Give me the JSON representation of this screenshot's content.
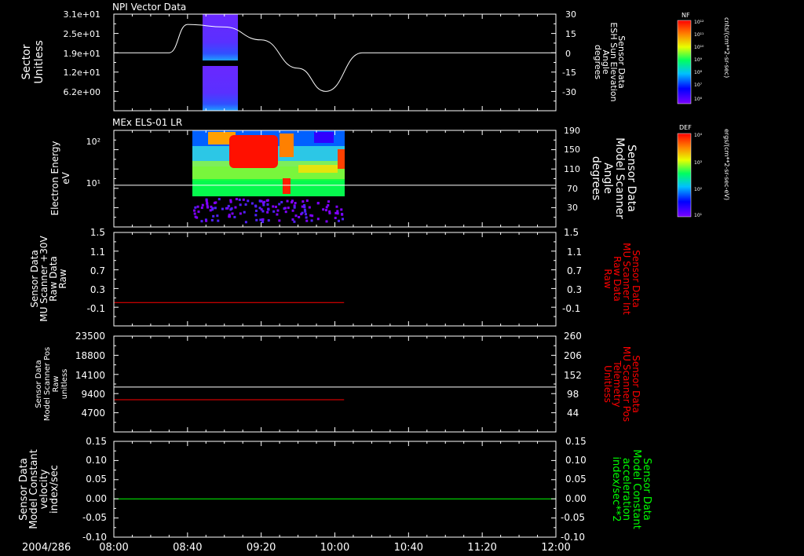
{
  "date_label": "2004/286",
  "x_ticks": [
    "08:00",
    "08:40",
    "09:20",
    "10:00",
    "10:40",
    "11:20",
    "12:00"
  ],
  "colorbars": [
    {
      "tag": "NF",
      "unit": "cnts/(cm**2-sr-sec)",
      "ticks": [
        "10¹²",
        "10¹¹",
        "10¹⁰",
        "10⁹",
        "10⁸",
        "10⁷",
        "10⁶"
      ]
    },
    {
      "tag": "DEF",
      "unit": "ergs/(cm**2-sr-sec-eV)",
      "ticks": [
        "10⁴",
        "10³",
        "10²",
        "10¹"
      ]
    }
  ],
  "colors": {
    "white": "#ffffff",
    "red": "#ff0000",
    "green": "#00ff00",
    "frame": "#ffffff"
  },
  "chart_data": [
    {
      "type": "heatmap",
      "title": "NPI Vector Data",
      "ylabel_left": [
        "Sector",
        "Unitless"
      ],
      "left_ticks": [
        "3.1e+01",
        "2.5e+01",
        "1.9e+01",
        "1.2e+01",
        "6.2e+00"
      ],
      "ylabel_right": [
        "Sensor Data",
        "ESH Sun Elevation",
        "Angle",
        "degrees"
      ],
      "right_ticks": [
        "30",
        "15",
        "0",
        "-15",
        "-30"
      ],
      "right_ylim": [
        -45,
        30
      ],
      "line_color": "#ffffff",
      "line_series": {
        "x": [
          "08:00",
          "08:30",
          "08:40",
          "09:00",
          "09:20",
          "09:40",
          "09:55",
          "10:15",
          "12:00"
        ],
        "y": [
          0,
          0,
          22,
          20,
          10,
          -12,
          -30,
          0,
          0
        ]
      }
    },
    {
      "type": "heatmap",
      "title": "MEx ELS-01 LR",
      "ylabel_left": [
        "Electron Energy",
        "eV"
      ],
      "left_ticks": [
        "10²",
        "10¹"
      ],
      "ylabel_right": [
        "Sensor Data",
        "Model Scanner",
        "Angle",
        "degrees"
      ],
      "right_ticks": [
        "190",
        "150",
        "110",
        "70",
        "30"
      ],
      "right_ylim": [
        0,
        190
      ],
      "line_color": "#ffffff",
      "line_value": 82
    },
    {
      "type": "line",
      "ylabel_left": [
        "Sensor Data",
        "MU Scanner +30V",
        "Raw Data",
        "Raw"
      ],
      "left_ticks": [
        "1.5",
        "1.1",
        "0.7",
        "0.3",
        "-0.1"
      ],
      "ylim": [
        -0.5,
        1.5
      ],
      "ylabel_right": [
        "Sensor Data",
        "MU Scanner Int",
        "Raw Data",
        "Raw"
      ],
      "right_ticks": [
        "1.5",
        "1.1",
        "0.7",
        "0.3",
        "-0.1"
      ],
      "series": [
        {
          "color": "#ff0000",
          "x": [
            "08:00",
            "10:05"
          ],
          "y": [
            0,
            0
          ]
        }
      ]
    },
    {
      "type": "line",
      "ylabel_left": [
        "Sensor Data",
        "Model Scanner Pos",
        "Raw",
        "unitless"
      ],
      "left_ticks": [
        "23500",
        "18800",
        "14100",
        "9400",
        "4700"
      ],
      "ylim": [
        0,
        23500
      ],
      "ylabel_right": [
        "Sensor Data",
        "MU Scanner Pos",
        "Telemetry",
        "Unitless"
      ],
      "right_ticks": [
        "260",
        "206",
        "152",
        "98",
        "44"
      ],
      "right_ylim": [
        -10,
        260
      ],
      "series": [
        {
          "color": "#ffffff",
          "x": [
            "08:00",
            "12:00"
          ],
          "y": [
            11000,
            11000
          ]
        },
        {
          "color": "#ff0000",
          "x": [
            "08:00",
            "10:05"
          ],
          "y": [
            7900,
            7900
          ]
        }
      ]
    },
    {
      "type": "line",
      "ylabel_left": [
        "Sensor Data",
        "Model Constant",
        "velocity",
        "index/sec"
      ],
      "left_ticks": [
        "0.15",
        "0.10",
        "0.05",
        "0.00",
        "-0.05",
        "-0.10"
      ],
      "ylim": [
        -0.1,
        0.15
      ],
      "ylabel_right": [
        "Sensor Data",
        "Model Constant",
        "acceleration",
        "index/sec**2"
      ],
      "right_ticks": [
        "0.15",
        "0.10",
        "0.05",
        "0.00",
        "-0.05",
        "-0.10"
      ],
      "series": [
        {
          "color": "#00ff00",
          "x": [
            "08:00",
            "12:00"
          ],
          "y": [
            0,
            0
          ]
        }
      ]
    }
  ]
}
